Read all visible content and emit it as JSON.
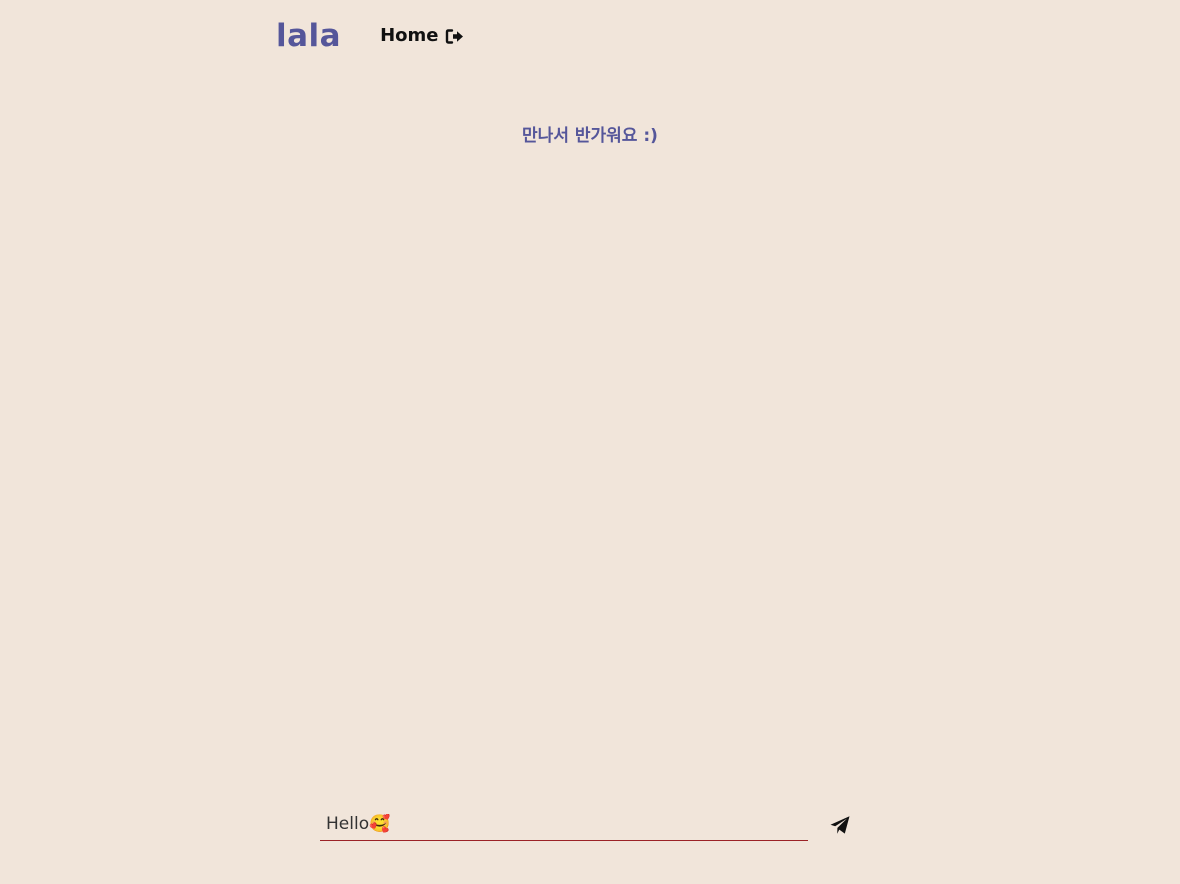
{
  "header": {
    "logo": "lala",
    "home_label": "Home",
    "home_icon": "sign-out-icon"
  },
  "main": {
    "greeting": "만나서 반가워요 :)"
  },
  "message": {
    "input_value": "Hello🥰",
    "send_icon": "paper-plane-icon"
  },
  "colors": {
    "background": "#f1e5da",
    "accent": "#55569a",
    "input_underline": "#9b2226",
    "text": "#111111"
  }
}
